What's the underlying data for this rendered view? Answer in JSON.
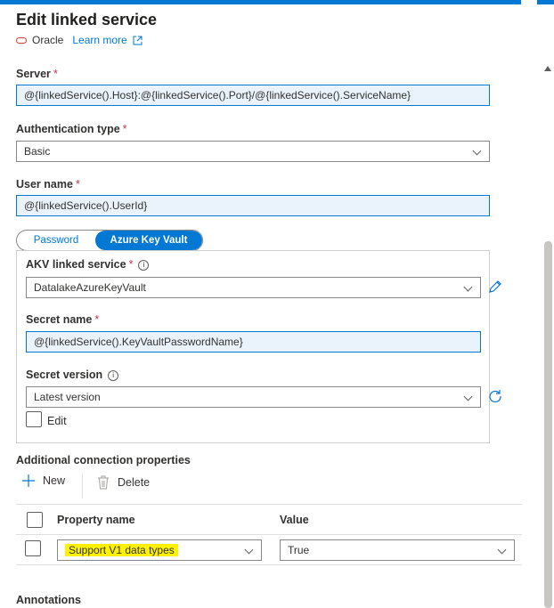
{
  "header": {
    "title": "Edit linked service",
    "service_type": "Oracle",
    "learn_more": "Learn more"
  },
  "form": {
    "server": {
      "label": "Server",
      "required": "*",
      "value": "@{linkedService().Host}:@{linkedService().Port}/@{linkedService().ServiceName}"
    },
    "auth_type": {
      "label": "Authentication type",
      "required": "*",
      "value": "Basic"
    },
    "user_name": {
      "label": "User name",
      "required": "*",
      "value": "@{linkedService().UserId}"
    },
    "password_toggle": {
      "option_password": "Password",
      "option_akv": "Azure Key Vault",
      "selected": "Azure Key Vault"
    },
    "akv": {
      "linked_service": {
        "label": "AKV linked service",
        "required": "*",
        "value": "DatalakeAzureKeyVault"
      },
      "secret_name": {
        "label": "Secret name",
        "required": "*",
        "value": "@{linkedService().KeyVaultPasswordName}"
      },
      "secret_version": {
        "label": "Secret version",
        "value": "Latest version"
      },
      "edit_label": "Edit"
    },
    "additional": {
      "label": "Additional connection properties",
      "new_button": "New",
      "delete_button": "Delete",
      "columns": [
        "Property name",
        "Value"
      ],
      "rows": [
        {
          "property": "Support V1 data types",
          "value": "True"
        }
      ]
    },
    "annotations_label": "Annotations"
  },
  "colors": {
    "accent": "#0078d4",
    "required": "#c4314b",
    "highlight": "#fff200"
  }
}
